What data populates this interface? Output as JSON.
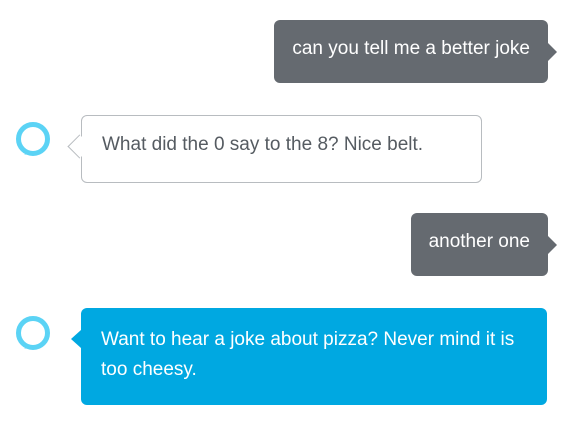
{
  "colors": {
    "user_bubble": "#656a70",
    "alexa_accent": "#00a8e1",
    "alexa_ring": "#5bd3f5",
    "bubble_border": "#b8bcc0",
    "alexa_text": "#555b61"
  },
  "conversation": {
    "messages": [
      {
        "sender": "user",
        "text": "can you tell me a better joke"
      },
      {
        "sender": "alexa",
        "icon": "alexa-logo-icon",
        "text": "What did the 0 say to the 8? Nice belt."
      },
      {
        "sender": "user",
        "text": "another one"
      },
      {
        "sender": "alexa",
        "icon": "alexa-logo-icon",
        "text": "Want to hear a joke about pizza? Never mind it is too cheesy."
      }
    ]
  }
}
